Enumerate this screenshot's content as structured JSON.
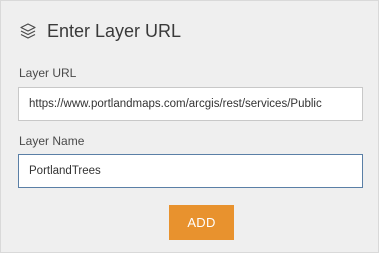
{
  "dialog": {
    "title": "Enter Layer URL",
    "icon": "layers-icon"
  },
  "layer_url": {
    "label": "Layer URL",
    "value": "https://www.portlandmaps.com/arcgis/rest/services/Public"
  },
  "layer_name": {
    "label": "Layer Name",
    "value": "PortlandTrees"
  },
  "add_button": {
    "label": "ADD"
  },
  "colors": {
    "panel_background": "#efefef",
    "accent": "#e8922e",
    "focused_border": "#5a7fa6"
  }
}
